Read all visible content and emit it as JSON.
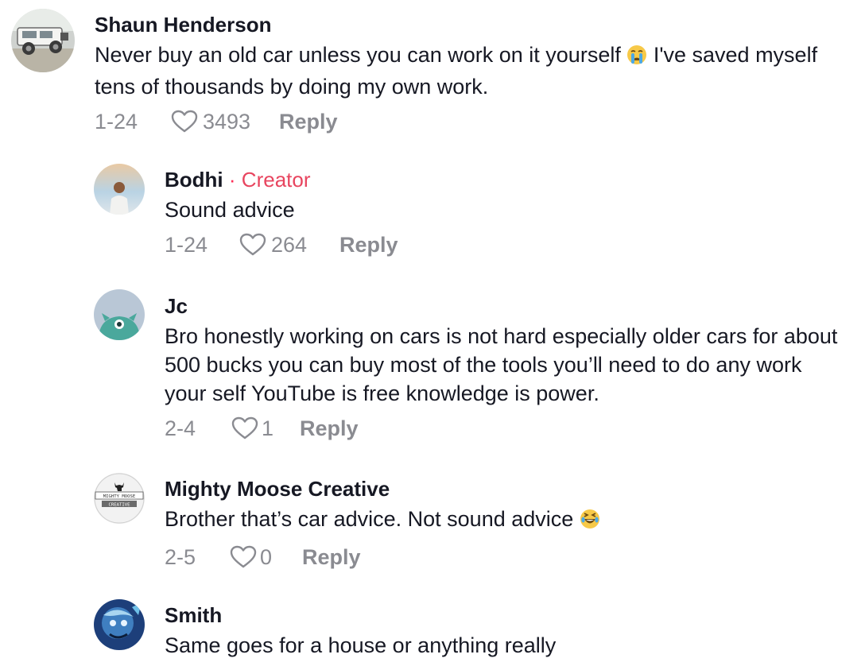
{
  "comments": [
    {
      "author": "Shaun Henderson",
      "text_before_emoji": "Never buy an old car unless you can work on it yourself ",
      "emoji": "crying-face",
      "text_after_emoji": " I've saved myself tens of thousands by doing my own work.",
      "date": "1-24",
      "likes": "3493",
      "reply_label": "Reply"
    },
    {
      "author": "Bodhi",
      "creator_separator": "·",
      "creator_label": "Creator",
      "text": "Sound advice",
      "date": "1-24",
      "likes": "264",
      "reply_label": "Reply"
    },
    {
      "author": "Jc",
      "text": "Bro honestly working on cars is not hard especially older cars for about 500 bucks you can buy most of the tools you’ll need to do any work your self YouTube is free knowledge is power.",
      "date": "2-4",
      "likes": "1",
      "reply_label": "Reply"
    },
    {
      "author": "Mighty Moose Creative",
      "avatar_text_top": "MIGHTY MOOSE",
      "avatar_text_bottom": "CREATIVE",
      "text_before_emoji": "Brother that’s car advice. Not sound advice ",
      "emoji": "laughing-face",
      "date": "2-5",
      "likes": "0",
      "reply_label": "Reply"
    },
    {
      "author": "Smith",
      "text": "Same goes for a house or anything really"
    }
  ],
  "colors": {
    "text": "#161823",
    "meta": "#8a8b91",
    "creator": "#e8455f"
  }
}
